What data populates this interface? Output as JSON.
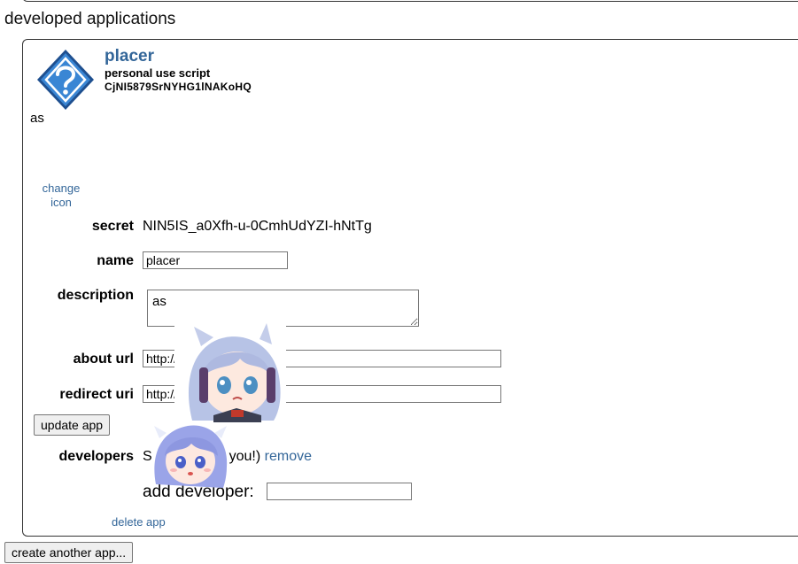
{
  "section": {
    "title": "developed applications"
  },
  "app": {
    "name": "placer",
    "type": "personal use script",
    "client_id": "CjNI5879SrNYHG1lNAKoHQ",
    "description": "as",
    "change_icon_label": "change icon",
    "icon": "question-mark-diamond-icon"
  },
  "form": {
    "secret_label": "secret",
    "secret_value": "NIN5IS_a0Xfh-u-0CmhUdYZI-hNtTg",
    "name_label": "name",
    "name_value": "placer",
    "description_label": "description",
    "description_value": "as",
    "about_url_label": "about url",
    "about_url_value": "http://",
    "redirect_uri_label": "redirect uri",
    "redirect_uri_value": "http://",
    "update_button": "update app",
    "developers_label": "developers",
    "developer_name_visible": "S",
    "developer_note_visible": "t's you!)",
    "remove_link": "remove",
    "add_developer_label": "add developer:",
    "add_developer_value": "",
    "delete_link": "delete app"
  },
  "footer": {
    "create_button": "create another app..."
  },
  "colors": {
    "link": "#336699",
    "icon_fill": "#3a78c2"
  }
}
